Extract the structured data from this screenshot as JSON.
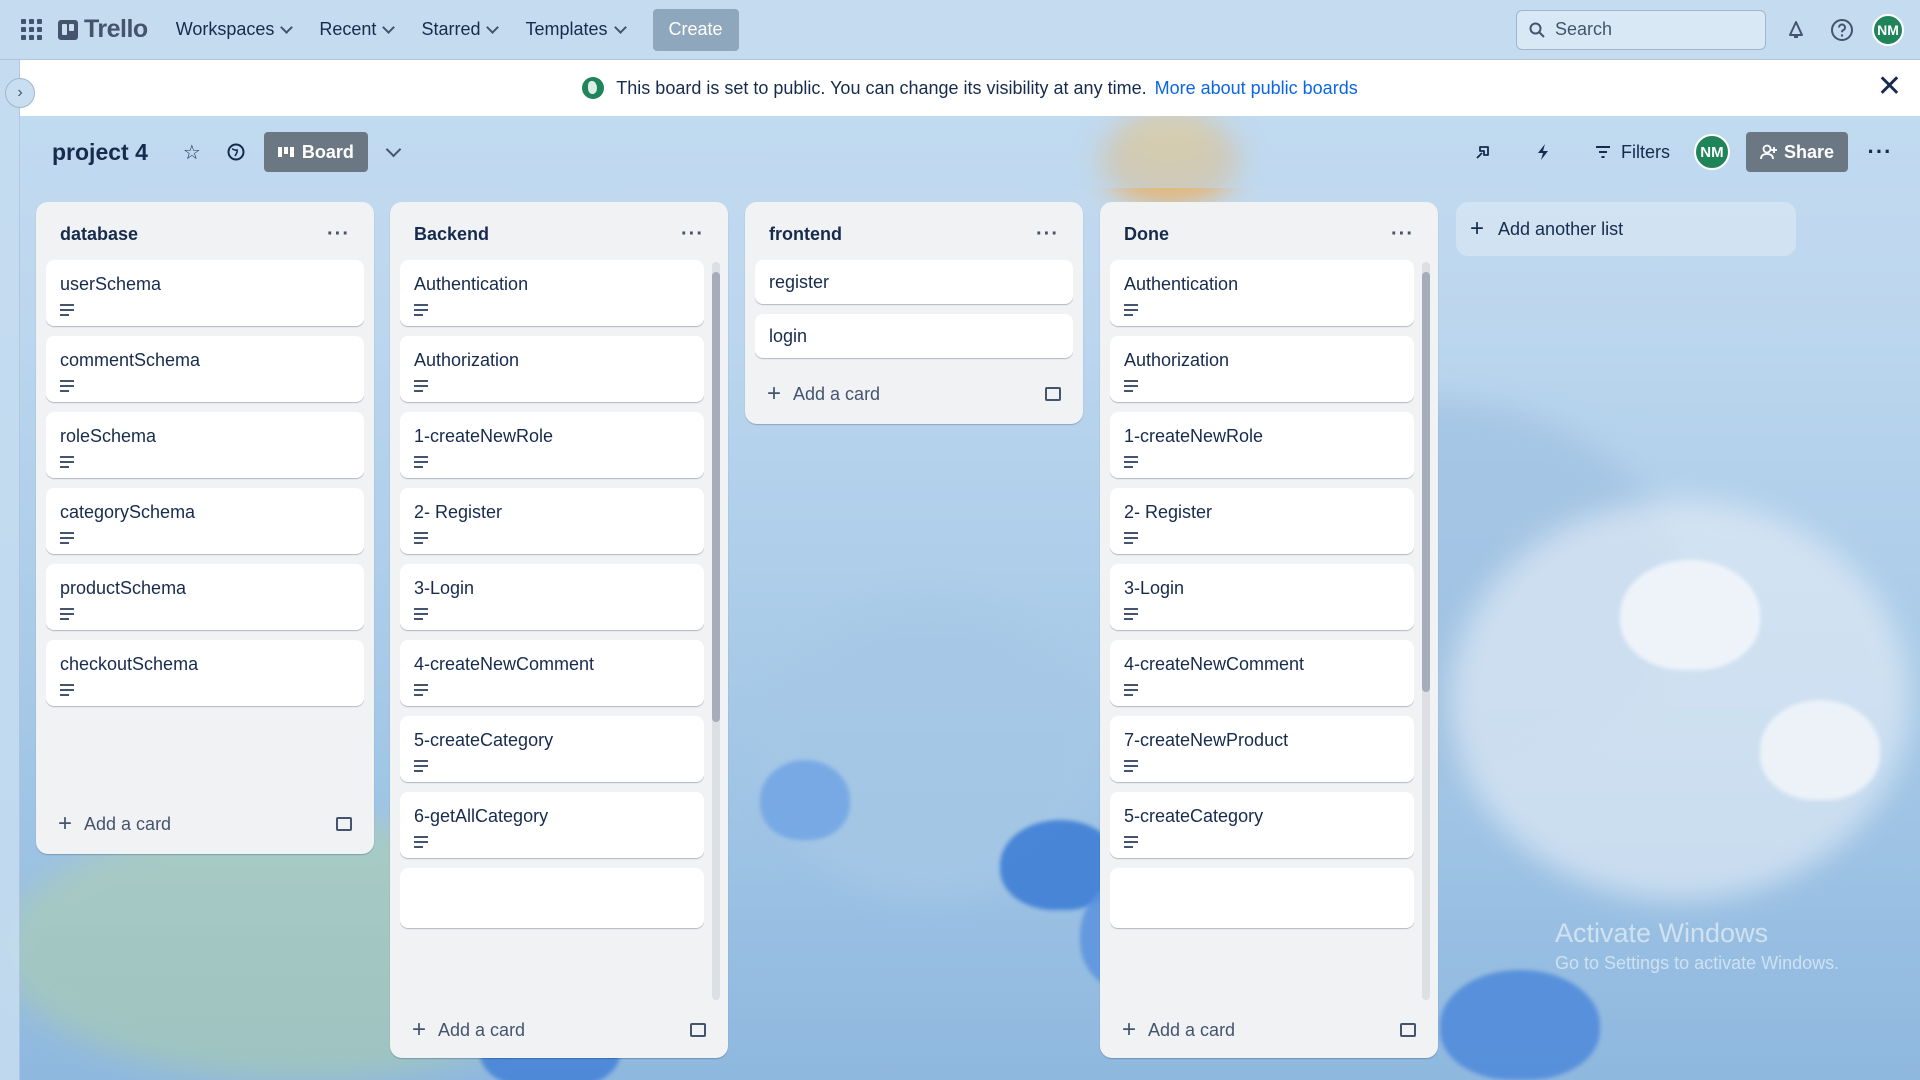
{
  "nav": {
    "logo": "Trello",
    "workspaces": "Workspaces",
    "recent": "Recent",
    "starred": "Starred",
    "templates": "Templates",
    "create": "Create",
    "search_placeholder": "Search",
    "avatar_initials": "NM"
  },
  "banner": {
    "message": "This board is set to public. You can change its visibility at any time.",
    "link": "More about public boards"
  },
  "board": {
    "title": "project 4",
    "view_label": "Board",
    "filters_label": "Filters",
    "share_label": "Share",
    "avatar_initials": "NM"
  },
  "lists": [
    {
      "title": "database",
      "cards": [
        "userSchema",
        "commentSchema",
        "roleSchema",
        "categorySchema",
        "productSchema",
        "checkoutSchema"
      ],
      "add_card": "Add a card"
    },
    {
      "title": "Backend",
      "cards": [
        "Authentication",
        "Authorization",
        "1-createNewRole",
        "2- Register",
        "3-Login",
        "4-createNewComment",
        "5-createCategory",
        "6-getAllCategory"
      ],
      "add_card": "Add a card"
    },
    {
      "title": "frontend",
      "cards": [
        "register",
        "login"
      ],
      "add_card": "Add a card"
    },
    {
      "title": "Done",
      "cards": [
        "Authentication",
        "Authorization",
        "1-createNewRole",
        "2- Register",
        "3-Login",
        "4-createNewComment",
        "7-createNewProduct",
        "5-createCategory"
      ],
      "add_card": "Add a card"
    }
  ],
  "add_list": "Add another list",
  "watermark": {
    "line1": "Activate Windows",
    "line2": "Go to Settings to activate Windows."
  },
  "colors": {
    "avatar": "#1f845a",
    "link": "#0c66e4",
    "list_bg": "#f1f2f4"
  }
}
